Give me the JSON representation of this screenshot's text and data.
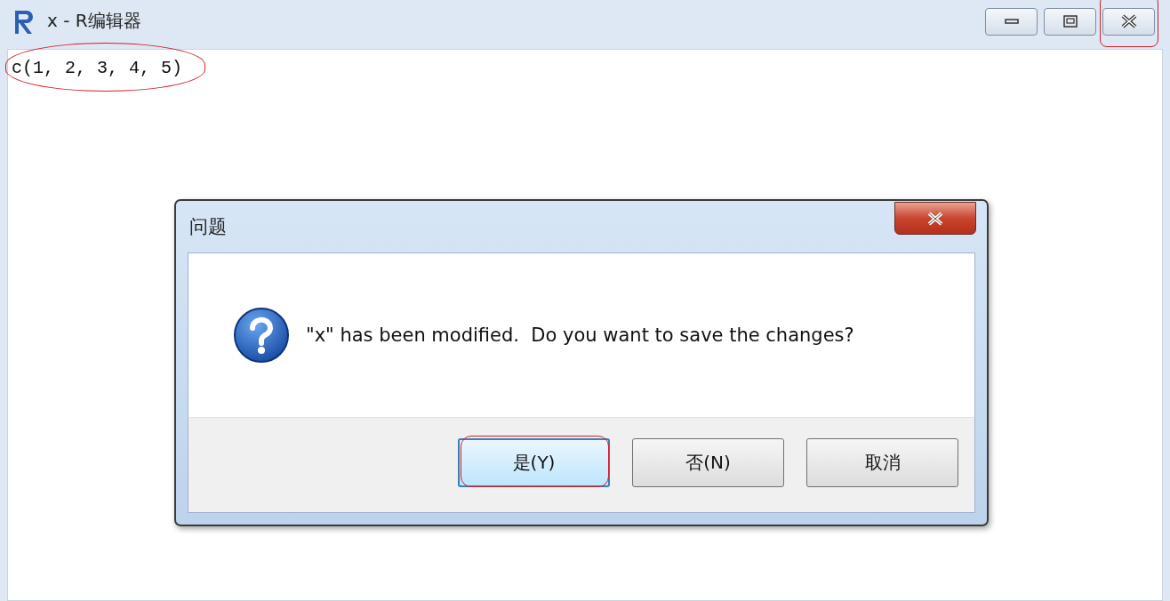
{
  "window": {
    "title": "x - R编辑器",
    "controls": [
      {
        "kind": "minimize",
        "highlighted": false
      },
      {
        "kind": "restore",
        "highlighted": false
      },
      {
        "kind": "close",
        "highlighted": true
      }
    ]
  },
  "editor": {
    "lines": [
      {
        "text": "c(1, 2, 3, 4, 5)",
        "highlighted": true
      }
    ]
  },
  "dialog": {
    "title": "问题",
    "message": "\"x\" has been modified.  Do you want to save the changes?",
    "buttons": [
      {
        "label": "是(Y)",
        "default": true,
        "highlighted": true
      },
      {
        "label": "否(N)",
        "default": false,
        "highlighted": false
      },
      {
        "label": "取消",
        "default": false,
        "highlighted": false
      }
    ]
  }
}
